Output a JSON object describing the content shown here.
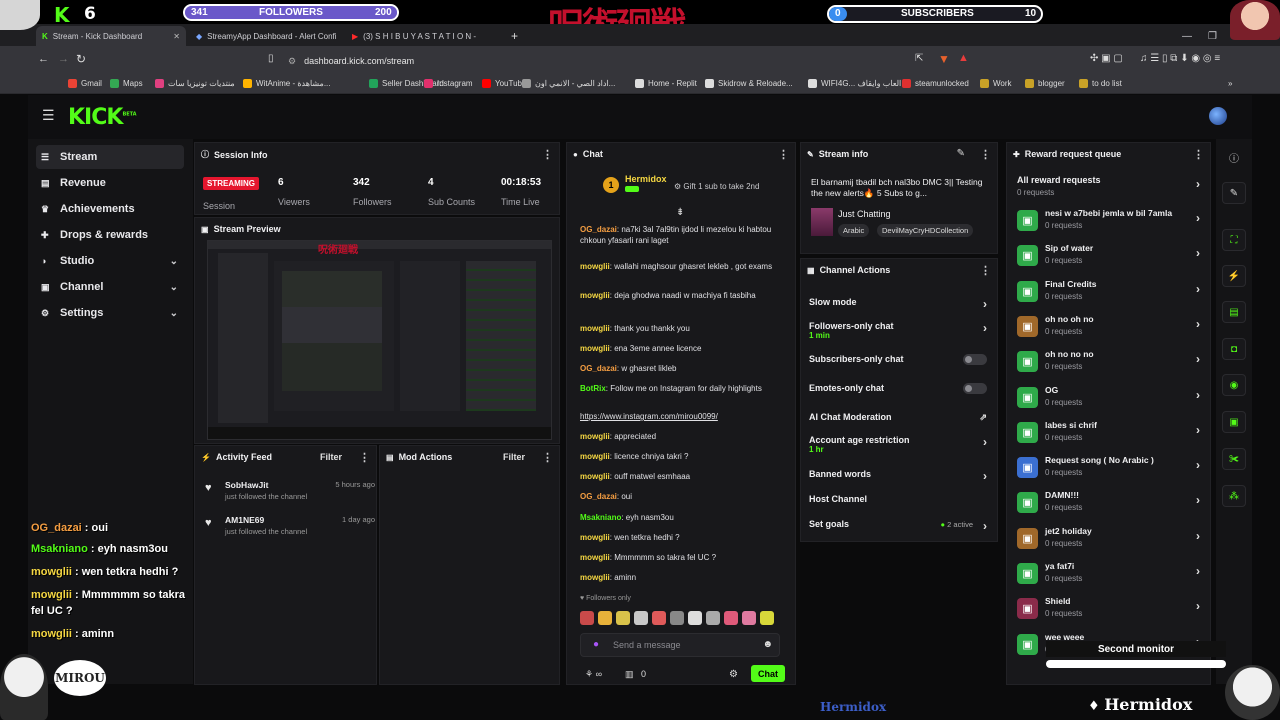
{
  "overlay": {
    "kick_count": "6",
    "followers_bar": {
      "left": "341",
      "label": "FOLLOWERS",
      "right": "200",
      "progress": 1.0
    },
    "subscribers_bar": {
      "left": "0",
      "label": "SUBSCRIBERS",
      "right": "10",
      "progress": 0.0
    },
    "jp_title": "呪術廻戦",
    "chat_overlay": [
      {
        "user": "OG_dazai",
        "msg": " : oui",
        "color": "#f59e42"
      },
      {
        "user": "Msakniano",
        "msg": " : eyh nasm3ou",
        "color": "#53fc18"
      },
      {
        "user": "mowglii",
        "msg": " : wen tetkra hedhi ?",
        "color": "#f5d742"
      },
      {
        "user": "mowglii",
        "msg": " : Mmmmmm so takra",
        "color": "#f5d742"
      },
      {
        "user": "",
        "msg": "fel UC ?",
        "color": "#ffffff"
      },
      {
        "user": "mowglii",
        "msg": " : aminn",
        "color": "#f5d742"
      }
    ],
    "mirou_badge": "MIROU",
    "second_monitor": "Second monitor",
    "watermark": "Hermidox",
    "bottom_brand": "Hermidox"
  },
  "browser": {
    "tabs": [
      {
        "title": "Stream - Kick Dashboard",
        "active": true
      },
      {
        "title": "StreamyApp Dashboard - Alert Confi",
        "active": false
      },
      {
        "title": "(3) S H I B U Y A  S T A T I O N -",
        "active": false
      }
    ],
    "url": "dashboard.kick.com/stream",
    "bookmarks": [
      "Gmail",
      "Maps",
      "منتديات تونيزيا سات",
      "WitAnime - مشاهدة...",
      "Seller Dashboard",
      "Instagram",
      "YouTube",
      "اداد الصي - الانمي اون...",
      "Home - Replit",
      "Skidrow & Reloade...",
      "WIFI4G... العاب وايقاف",
      "steamunlocked",
      "Work",
      "blogger",
      "to do list"
    ]
  },
  "app": {
    "logo": "KICK",
    "logo_tag": "BETA",
    "sidebar": [
      {
        "label": "Stream",
        "icon": "list-icon",
        "active": true,
        "expand": false
      },
      {
        "label": "Revenue",
        "icon": "wallet-icon",
        "active": false,
        "expand": false
      },
      {
        "label": "Achievements",
        "icon": "trophy-icon",
        "active": false,
        "expand": false
      },
      {
        "label": "Drops & rewards",
        "icon": "gift-icon",
        "active": false,
        "expand": false
      },
      {
        "label": "Studio",
        "icon": "palette-icon",
        "active": false,
        "expand": true
      },
      {
        "label": "Channel",
        "icon": "channel-icon",
        "active": false,
        "expand": true
      },
      {
        "label": "Settings",
        "icon": "gear-icon",
        "active": false,
        "expand": true
      }
    ],
    "session": {
      "title": "Session Info",
      "status": "STREAMING",
      "status_label": "Session",
      "viewers": "6",
      "viewers_label": "Viewers",
      "followers": "342",
      "followers_label": "Followers",
      "subs": "4",
      "subs_label": "Sub Counts",
      "time": "00:18:53",
      "time_label": "Time Live"
    },
    "preview_title": "Stream Preview",
    "activity": {
      "title": "Activity Feed",
      "filter": "Filter",
      "items": [
        {
          "user": "SobHawJit",
          "text": "just followed the channel",
          "time": "5 hours ago"
        },
        {
          "user": "AM1NE69",
          "text": "just followed the channel",
          "time": "1 day ago"
        }
      ]
    },
    "mod": {
      "title": "Mod Actions",
      "filter": "Filter"
    },
    "chat": {
      "title": "Chat",
      "pinned_user": "Hermidox",
      "pinned_count": "1",
      "gift_text": "Gift 1 sub to take 2nd",
      "messages": [
        {
          "user": "OG_dazai",
          "color": "#f59e42",
          "text": ": na7ki 3al 7al9tin ijdod li mezelou ki habtou chkoun yfasarli rani laget"
        },
        {
          "user": "mowglii",
          "color": "#f5d742",
          "text": ": wallahi maghsour ghasret lekleb , got exams"
        },
        {
          "user": "mowglii",
          "color": "#f5d742",
          "text": ": deja ghodwa naadi w machiya fi tasbiha"
        },
        {
          "user": "mowglii",
          "color": "#f5d742",
          "text": ": thank you thankk you"
        },
        {
          "user": "mowglii",
          "color": "#f5d742",
          "text": ": ena 3eme annee licence"
        },
        {
          "user": "OG_dazai",
          "color": "#f59e42",
          "text": ": w ghasret likleb"
        },
        {
          "user": "BotRix",
          "color": "#53fc18",
          "text": ": Follow me on Instagram for daily highlights"
        },
        {
          "user": "",
          "color": "#ffffff",
          "text": "https://www.instagram.com/mirou0099/"
        },
        {
          "user": "mowglii",
          "color": "#f5d742",
          "text": ": appreciated"
        },
        {
          "user": "mowglii",
          "color": "#f5d742",
          "text": ": licence chniya takri ?"
        },
        {
          "user": "mowglii",
          "color": "#f5d742",
          "text": ": ouff matwel esmhaaa"
        },
        {
          "user": "OG_dazai",
          "color": "#f59e42",
          "text": ": oui"
        },
        {
          "user": "Msakniano",
          "color": "#53fc18",
          "text": ": eyh nasm3ou"
        },
        {
          "user": "mowglii",
          "color": "#f5d742",
          "text": ": wen tetkra hedhi ?"
        },
        {
          "user": "mowglii",
          "color": "#f5d742",
          "text": ": Mmmmmm so takra fel UC ?"
        },
        {
          "user": "mowglii",
          "color": "#f5d742",
          "text": ": aminn"
        }
      ],
      "followers_only": "Followers only",
      "placeholder": "Send a message",
      "points": "0",
      "send": "Chat"
    },
    "stream_info": {
      "title": "Stream info",
      "stream_title": "El barnamij tbadil bch nal3bo DMC 3|| Testing the new alerts🔥 5 Subs to g...",
      "category": "Just Chatting",
      "tags": [
        "Arabic",
        "DevilMayCryHDCollection"
      ]
    },
    "channel_actions": {
      "title": "Channel Actions",
      "items": [
        {
          "label": "Slow mode",
          "sub": "",
          "control": "chevron"
        },
        {
          "label": "Followers-only chat",
          "sub": "1 min",
          "control": "chevron"
        },
        {
          "label": "Subscribers-only chat",
          "sub": "",
          "control": "toggle"
        },
        {
          "label": "Emotes-only chat",
          "sub": "",
          "control": "toggle"
        },
        {
          "label": "AI Chat Moderation",
          "sub": "",
          "control": "external"
        },
        {
          "label": "Account age restriction",
          "sub": "1 hr",
          "control": "chevron"
        },
        {
          "label": "Banned words",
          "sub": "",
          "control": "chevron"
        },
        {
          "label": "Host Channel",
          "sub": "",
          "control": "none"
        },
        {
          "label": "Set goals",
          "sub": "",
          "control": "chevron",
          "badge": "2 active"
        }
      ]
    },
    "rewards": {
      "title": "Reward request queue",
      "all_label": "All reward requests",
      "all_sub": "0 requests",
      "items": [
        {
          "name": "nesi w a7bebi jemla w bil 7amla",
          "sub": "0 requests",
          "color": "#2faa4a"
        },
        {
          "name": "Sip of water",
          "sub": "0 requests",
          "color": "#2faa4a"
        },
        {
          "name": "Final Credits",
          "sub": "0 requests",
          "color": "#2faa4a"
        },
        {
          "name": "oh no oh no",
          "sub": "0 requests",
          "color": "#a0682a"
        },
        {
          "name": "oh no no no",
          "sub": "0 requests",
          "color": "#2faa4a"
        },
        {
          "name": "OG",
          "sub": "0 requests",
          "color": "#2faa4a"
        },
        {
          "name": "labes si chrif",
          "sub": "0 requests",
          "color": "#2faa4a"
        },
        {
          "name": "Request song ( No Arabic )",
          "sub": "0 requests",
          "color": "#3b6fd1"
        },
        {
          "name": "DAMN!!!",
          "sub": "0 requests",
          "color": "#2faa4a"
        },
        {
          "name": "jet2 holiday",
          "sub": "0 requests",
          "color": "#a0682a"
        },
        {
          "name": "ya fat7i",
          "sub": "0 requests",
          "color": "#2faa4a"
        },
        {
          "name": "Shield",
          "sub": "0 requests",
          "color": "#8a2b4a"
        },
        {
          "name": "wee weee",
          "sub": "0 requests",
          "color": "#2faa4a"
        }
      ]
    },
    "accent": "#53fc18"
  }
}
